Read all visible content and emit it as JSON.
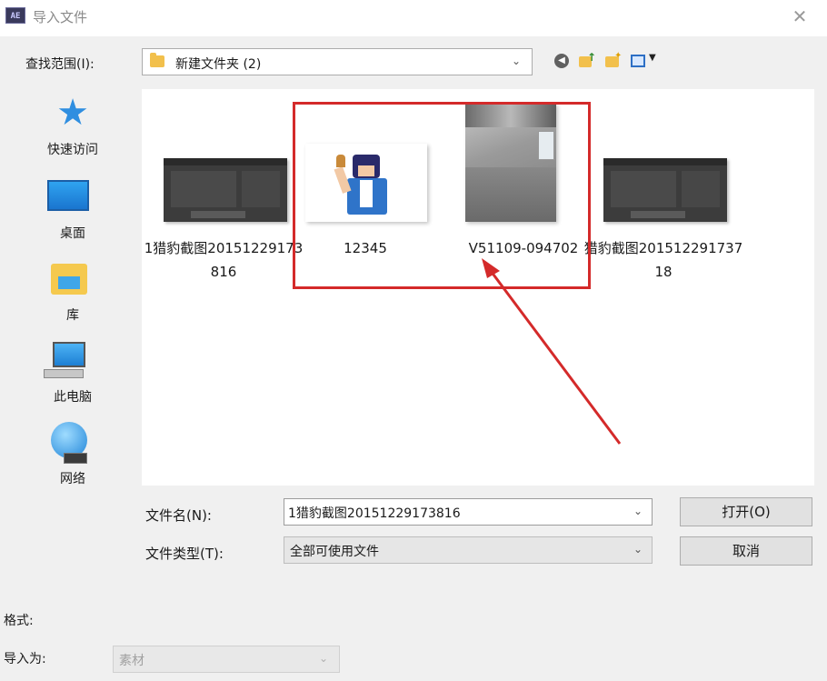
{
  "window": {
    "title": "导入文件",
    "app_icon_text": "AE",
    "close_glyph": "✕"
  },
  "lookin": {
    "label": "查找范围(I):",
    "value": "新建文件夹 (2)"
  },
  "toolbar_icons": [
    "back-icon",
    "up-folder-icon",
    "new-folder-icon",
    "view-menu-icon"
  ],
  "sidebar": {
    "items": [
      {
        "label": "快速访问",
        "icon": "star-icon"
      },
      {
        "label": "桌面",
        "icon": "desktop-icon"
      },
      {
        "label": "库",
        "icon": "library-icon"
      },
      {
        "label": "此电脑",
        "icon": "computer-icon"
      },
      {
        "label": "网络",
        "icon": "network-icon"
      }
    ]
  },
  "files": [
    {
      "name": "1猎豹截图20151229173816",
      "thumb": "dark-screenshot"
    },
    {
      "name": "12345",
      "thumb": "avatar-image"
    },
    {
      "name": "V51109-094702",
      "thumb": "photo"
    },
    {
      "name": "猎豹截图20151229173718",
      "thumb": "dark-screenshot"
    }
  ],
  "annotation": {
    "color": "#d42a2a"
  },
  "filename": {
    "label": "文件名(N):",
    "value": "1猎豹截图20151229173816"
  },
  "filetype": {
    "label": "文件类型(T):",
    "value": "全部可使用文件"
  },
  "buttons": {
    "open": "打开(O)",
    "cancel": "取消"
  },
  "format": {
    "label": "格式:"
  },
  "import_as": {
    "label": "导入为:",
    "value": "素材"
  }
}
